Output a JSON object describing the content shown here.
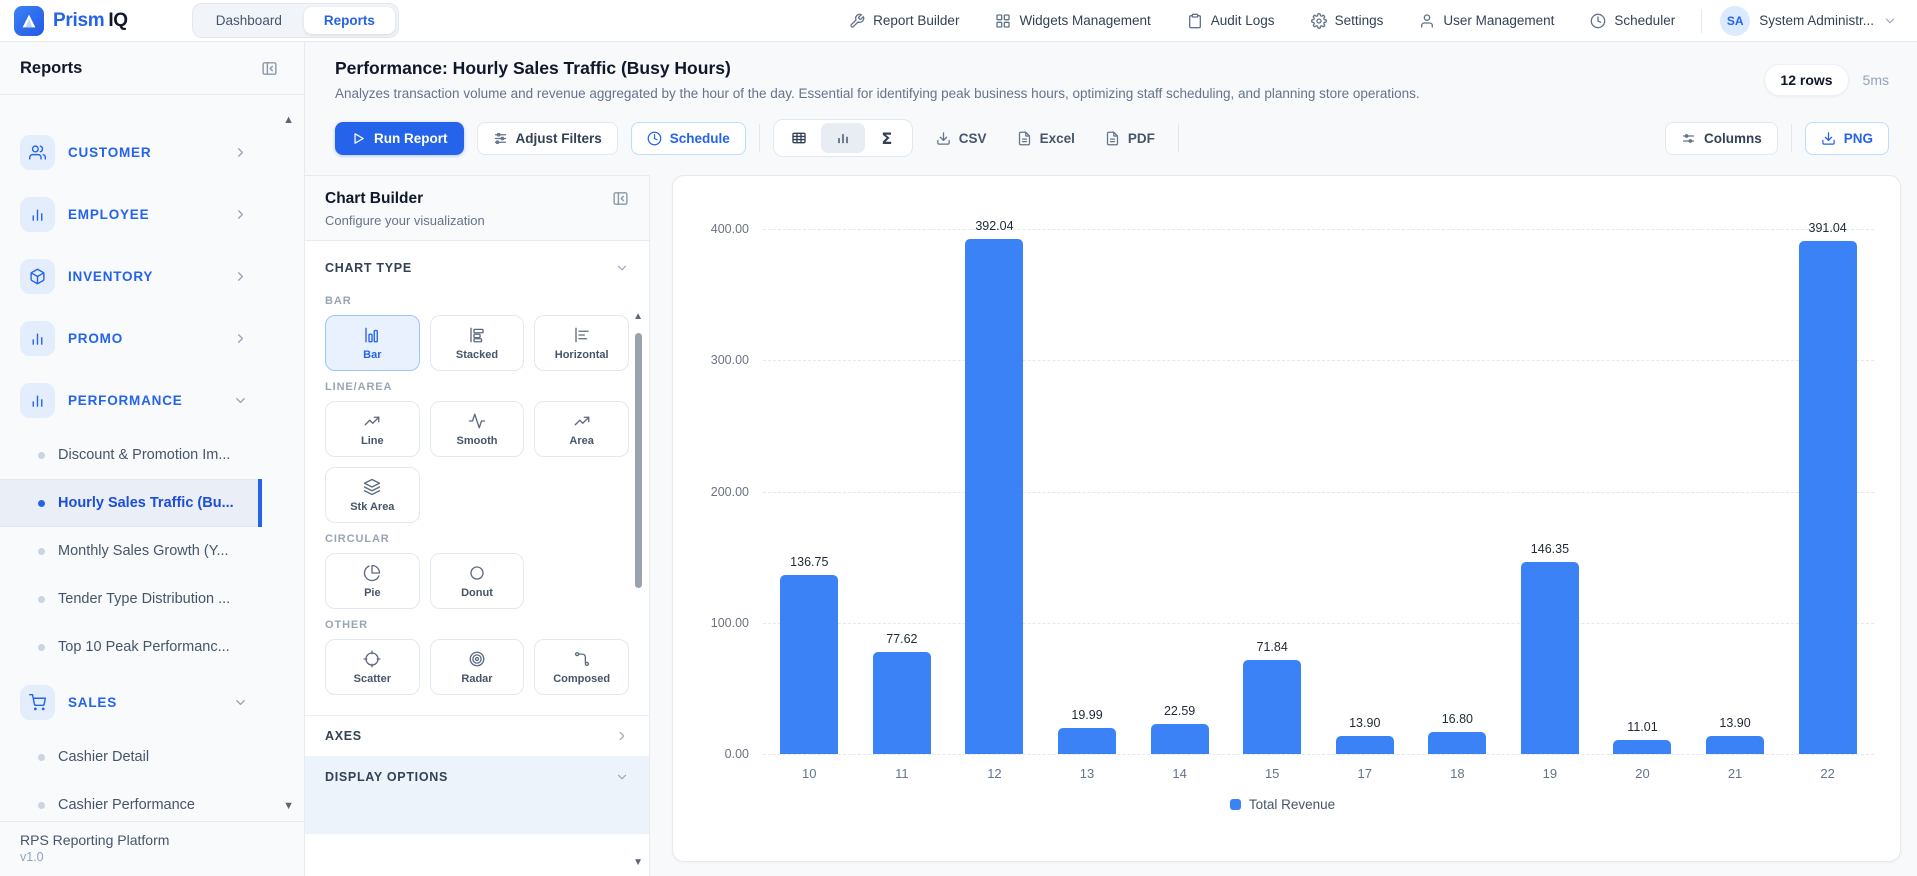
{
  "navbar": {
    "logo_text_primary": "Prism",
    "logo_text_secondary": "IQ",
    "tabs": [
      {
        "label": "Dashboard",
        "active": false
      },
      {
        "label": "Reports",
        "active": true
      }
    ],
    "links": [
      {
        "label": "Report Builder",
        "icon": "wrench"
      },
      {
        "label": "Widgets Management",
        "icon": "widgets"
      },
      {
        "label": "Audit Logs",
        "icon": "clipboard"
      },
      {
        "label": "Settings",
        "icon": "gear"
      },
      {
        "label": "User Management",
        "icon": "user"
      },
      {
        "label": "Scheduler",
        "icon": "clock"
      }
    ],
    "user": {
      "initials": "SA",
      "name": "System Administr...",
      "menu_state": "collapsed"
    }
  },
  "sidebar": {
    "title": "Reports",
    "categories": [
      {
        "label": "CUSTOMER",
        "icon": "users",
        "expanded": false,
        "items": []
      },
      {
        "label": "EMPLOYEE",
        "icon": "bar-chart",
        "expanded": false,
        "items": []
      },
      {
        "label": "INVENTORY",
        "icon": "package",
        "expanded": false,
        "items": []
      },
      {
        "label": "PROMO",
        "icon": "bar-chart",
        "expanded": false,
        "items": []
      },
      {
        "label": "PERFORMANCE",
        "icon": "bar-chart",
        "expanded": true,
        "items": [
          {
            "label": "Discount & Promotion Im...",
            "active": false
          },
          {
            "label": "Hourly Sales Traffic (Bu...",
            "active": true
          },
          {
            "label": "Monthly Sales Growth (Y...",
            "active": false
          },
          {
            "label": "Tender Type Distribution ...",
            "active": false
          },
          {
            "label": "Top 10 Peak Performanc...",
            "active": false
          }
        ]
      },
      {
        "label": "SALES",
        "icon": "cart",
        "expanded": true,
        "items": [
          {
            "label": "Cashier Detail",
            "active": false
          },
          {
            "label": "Cashier Performance",
            "active": false
          }
        ]
      }
    ],
    "footer": {
      "line1": "RPS Reporting Platform",
      "line2": "v1.0"
    }
  },
  "report_header": {
    "title": "Performance: Hourly Sales Traffic (Busy Hours)",
    "description": "Analyzes transaction volume and revenue aggregated by the hour of the day. Essential for identifying peak business hours, optimizing staff scheduling, and planning store operations.",
    "rows_badge": "12 rows",
    "elapsed": "5ms"
  },
  "toolbar": {
    "run_report": "Run Report",
    "adjust_filters": "Adjust Filters",
    "schedule": "Schedule",
    "view_toggle": [
      {
        "icon": "table",
        "active": false
      },
      {
        "icon": "chart",
        "active": true
      },
      {
        "icon": "sigma",
        "active": false
      }
    ],
    "exports": [
      {
        "label": "CSV",
        "icon": "download"
      },
      {
        "label": "Excel",
        "icon": "file"
      },
      {
        "label": "PDF",
        "icon": "file"
      }
    ],
    "columns": "Columns",
    "png": "PNG"
  },
  "chart_builder": {
    "title": "Chart Builder",
    "subtitle": "Configure your visualization",
    "sections": [
      {
        "label": "CHART TYPE",
        "expanded": true
      },
      {
        "label": "AXES",
        "expanded": false
      },
      {
        "label": "DISPLAY OPTIONS",
        "expanded": true
      }
    ],
    "groups": [
      {
        "label": "BAR",
        "options": [
          {
            "label": "Bar",
            "icon": "bar",
            "selected": true
          },
          {
            "label": "Stacked",
            "icon": "stacked",
            "selected": false
          },
          {
            "label": "Horizontal",
            "icon": "horizontal",
            "selected": false
          }
        ]
      },
      {
        "label": "LINE/AREA",
        "options": [
          {
            "label": "Line",
            "icon": "line",
            "selected": false
          },
          {
            "label": "Smooth",
            "icon": "smooth",
            "selected": false
          },
          {
            "label": "Area",
            "icon": "area",
            "selected": false
          },
          {
            "label": "Stk Area",
            "icon": "stk-area",
            "selected": false
          }
        ]
      },
      {
        "label": "CIRCULAR",
        "options": [
          {
            "label": "Pie",
            "icon": "pie",
            "selected": false
          },
          {
            "label": "Donut",
            "icon": "donut",
            "selected": false
          }
        ]
      },
      {
        "label": "OTHER",
        "options": [
          {
            "label": "Scatter",
            "icon": "scatter",
            "selected": false
          },
          {
            "label": "Radar",
            "icon": "radar",
            "selected": false
          },
          {
            "label": "Composed",
            "icon": "composed",
            "selected": false
          }
        ]
      }
    ]
  },
  "chart_data": {
    "type": "bar",
    "categories": [
      "10",
      "11",
      "12",
      "13",
      "14",
      "15",
      "17",
      "18",
      "19",
      "20",
      "21",
      "22"
    ],
    "values": [
      136.75,
      77.62,
      392.04,
      19.99,
      22.59,
      71.84,
      13.9,
      16.8,
      146.35,
      11.01,
      13.9,
      391.04
    ],
    "value_labels": [
      "136.75",
      "77.62",
      "392.04",
      "19.99",
      "22.59",
      "71.84",
      "13.90",
      "16.80",
      "146.35",
      "11.01",
      "13.90",
      "391.04"
    ],
    "y_ticks": [
      "400.00",
      "300.00",
      "200.00",
      "100.00",
      "0.00"
    ],
    "ylim": [
      0,
      400
    ],
    "xlabel": "",
    "ylabel": "",
    "series_name": "Total Revenue",
    "bar_color": "#3b82f6",
    "grid": "horizontal-dashed",
    "legend_position": "bottom"
  }
}
